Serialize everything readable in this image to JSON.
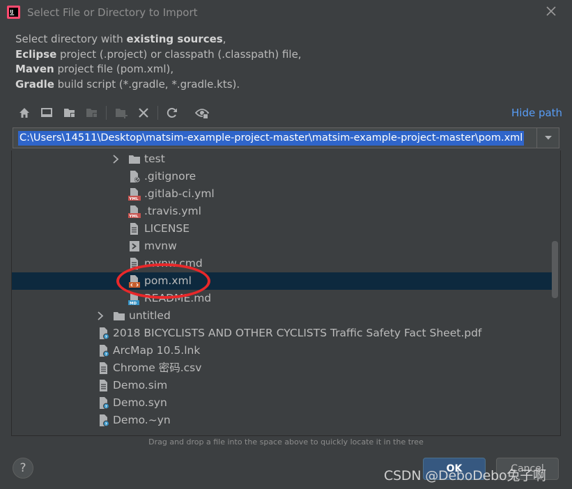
{
  "window": {
    "title": "Select File or Directory to Import"
  },
  "description": {
    "line1_pre": "Select directory with ",
    "line1_bold": "existing sources",
    "line1_post": ",",
    "line2_bold": "Eclipse",
    "line2_post": " project (.project) or classpath (.classpath) file,",
    "line3_bold": "Maven",
    "line3_post": " project file (pom.xml),",
    "line4_bold": "Gradle",
    "line4_post": " build script (*.gradle, *.gradle.kts)."
  },
  "toolbar": {
    "buttons": [
      "home-icon",
      "desktop-icon",
      "project-folder-icon",
      "module-folder-icon",
      "new-folder-icon",
      "delete-icon",
      "refresh-icon",
      "show-hidden-icon"
    ],
    "hide_path_label": "Hide path"
  },
  "path": {
    "value": "C:\\Users\\14511\\Desktop\\matsim-example-project-master\\matsim-example-project-master\\pom.xml"
  },
  "tree": {
    "rows": [
      {
        "label": "test",
        "icon": "folder-icon",
        "expandable": true
      },
      {
        "label": ".gitignore",
        "icon": "gitignore-file-icon",
        "expandable": false
      },
      {
        "label": ".gitlab-ci.yml",
        "icon": "yml-file-icon",
        "expandable": false
      },
      {
        "label": ".travis.yml",
        "icon": "yml-file-icon",
        "expandable": false
      },
      {
        "label": "LICENSE",
        "icon": "text-file-icon",
        "expandable": false
      },
      {
        "label": "mvnw",
        "icon": "shell-file-icon",
        "expandable": false
      },
      {
        "label": "mvnw.cmd",
        "icon": "text-file-icon",
        "expandable": false
      },
      {
        "label": "pom.xml",
        "icon": "maven-file-icon",
        "expandable": false,
        "selected": true
      },
      {
        "label": "README.md",
        "icon": "md-file-icon",
        "expandable": false
      },
      {
        "label": "untitled",
        "icon": "folder-icon",
        "expandable": true
      },
      {
        "label": "2018 BICYCLISTS AND OTHER CYCLISTS Traffic Safety Fact Sheet.pdf",
        "icon": "unknown-file-icon",
        "expandable": false
      },
      {
        "label": "ArcMap 10.5.lnk",
        "icon": "unknown-file-icon",
        "expandable": false
      },
      {
        "label": "Chrome 密码.csv",
        "icon": "text-file-icon",
        "expandable": false
      },
      {
        "label": "Demo.sim",
        "icon": "text-file-icon",
        "expandable": false
      },
      {
        "label": "Demo.syn",
        "icon": "unknown-file-icon",
        "expandable": false
      },
      {
        "label": "Demo.~yn",
        "icon": "unknown-file-icon",
        "expandable": false
      }
    ]
  },
  "hint": "Drag and drop a file into the space above to quickly locate it in the tree",
  "buttons": {
    "help": "?",
    "ok": "OK",
    "cancel": "Cancel"
  },
  "watermark": "CSDN @DeboDebo兔子啊",
  "colors": {
    "background": "#3c3f41",
    "selection": "#0d293e",
    "path_highlight": "#2f65ca",
    "link": "#589df6",
    "annotation_circle": "#e8282a"
  }
}
